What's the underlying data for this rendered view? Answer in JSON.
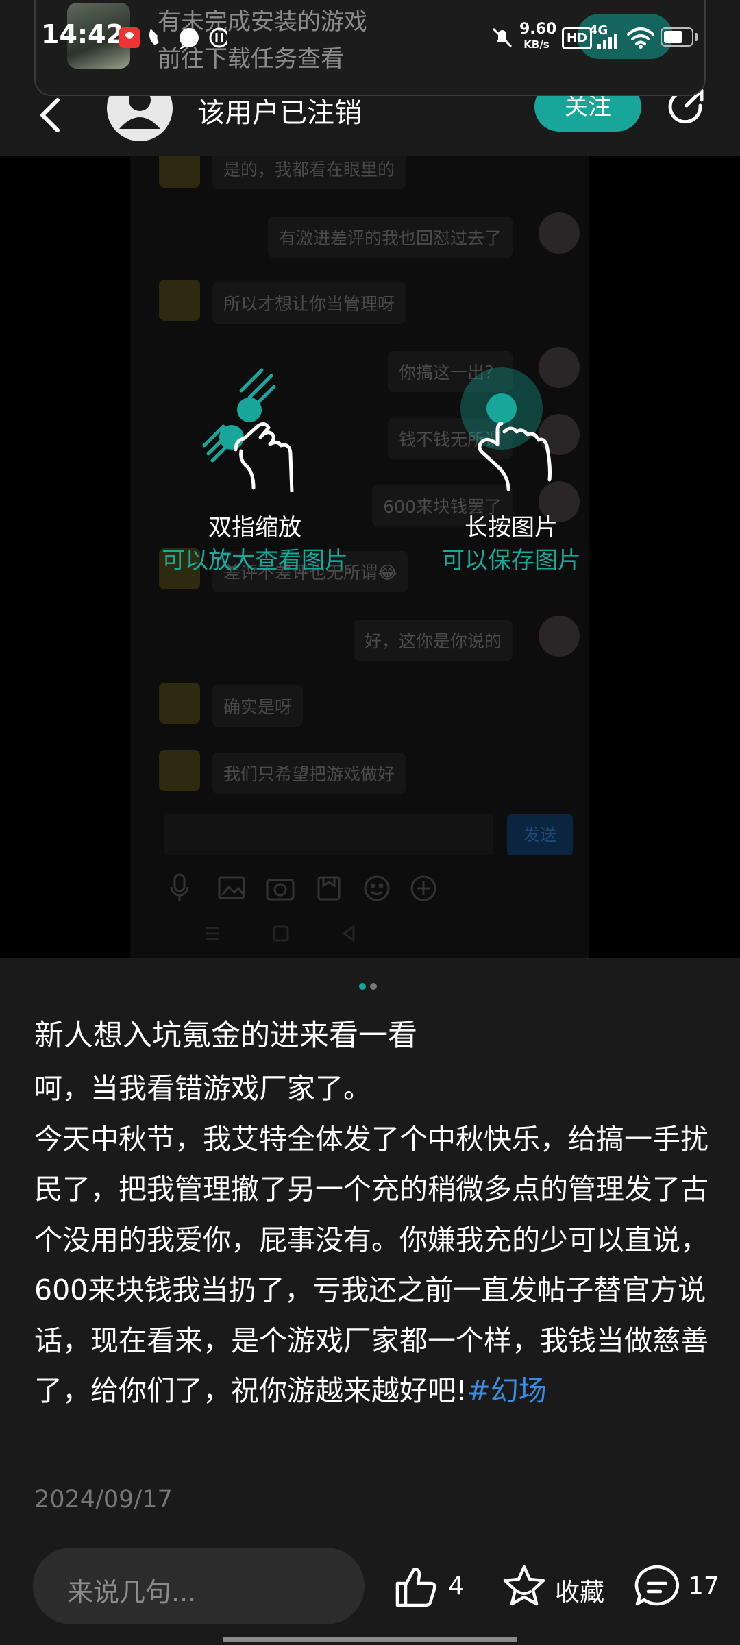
{
  "statusbar": {
    "time": "14:42",
    "net_speed_value": "9.60",
    "net_speed_unit": "KB/s",
    "hd_badge": "HD",
    "signal_label": "4G",
    "battery_level": 0.7
  },
  "notification": {
    "title": "有未完成安装的游戏",
    "subtitle": "前往下载任务查看"
  },
  "header": {
    "username": "该用户已注销",
    "follow_label": "关注"
  },
  "viewer": {
    "hint_pinch_title": "双指缩放",
    "hint_pinch_sub": "可以放大查看图片",
    "hint_press_title": "长按图片",
    "hint_press_sub": "可以保存图片",
    "page_count": 2,
    "current_page": 1,
    "chat": {
      "messages": [
        {
          "side": "left",
          "text": "是的，我都看在眼里的"
        },
        {
          "side": "right",
          "text": "有激进差评的我也回怼过去了"
        },
        {
          "side": "left",
          "text": "所以才想让你当管理呀"
        },
        {
          "side": "right",
          "text": "你搞这一出？"
        },
        {
          "side": "right",
          "text": "钱不钱无所谓"
        },
        {
          "side": "right",
          "text": "600来块钱罢了"
        },
        {
          "side": "left",
          "text": "差评不差评也无所谓😂"
        },
        {
          "side": "right",
          "text": "好，这你是你说的"
        },
        {
          "side": "left",
          "text": "确实是呀"
        },
        {
          "side": "left",
          "text": "我们只希望把游戏做好"
        }
      ],
      "send_label": "发送"
    }
  },
  "post": {
    "title": "新人想入坑氪金的进来看一看",
    "body_line1": "呵，当我看错游戏厂家了。",
    "body_main": "今天中秋节，我艾特全体发了个中秋快乐，给搞一手扰民了，把我管理撤了另一个充的稍微多点的管理发了古个没用的我爱你，屁事没有。你嫌我充的少可以直说，600来块钱我当扔了，亏我还之前一直发帖子替官方说话，现在看来，是个游戏厂家都一个样，我钱当做慈善了，给你们了，祝你游越来越好吧!",
    "hashtag": "#幻场",
    "date": "2024/09/17"
  },
  "bottom_bar": {
    "comment_placeholder": "来说几句...",
    "like_count": "4",
    "favorite_label": "收藏",
    "comment_count": "17"
  },
  "colors": {
    "accent": "#18a69a",
    "hashtag": "#3d8be0",
    "background": "#1a1a1a"
  }
}
